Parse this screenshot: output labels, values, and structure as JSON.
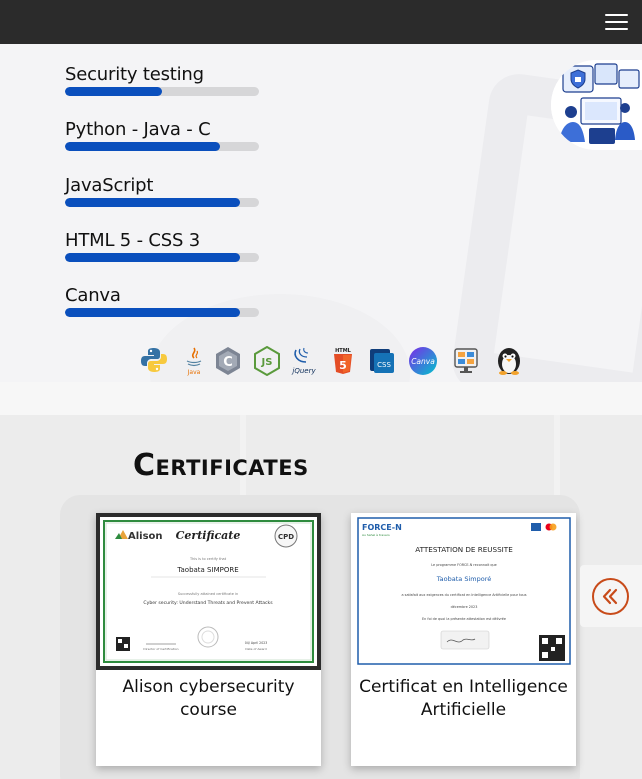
{
  "skills": [
    {
      "name": "Security testing",
      "level": 0.5
    },
    {
      "name": "Python - Java - C",
      "level": 0.8
    },
    {
      "name": "JavaScript",
      "level": 0.9
    },
    {
      "name": "HTML 5 - CSS 3",
      "level": 0.9
    },
    {
      "name": "Canva",
      "level": 0.9
    }
  ],
  "tech_icons": [
    "python-icon",
    "java-icon",
    "c-icon",
    "nodejs-icon",
    "jquery-icon",
    "html5-icon",
    "css3-icon",
    "canva-icon",
    "monitor-icon",
    "linux-icon"
  ],
  "tech_labels": {
    "java": "Java",
    "jquery": "jQuery",
    "html": "HTML",
    "css": "CSS",
    "canva": "Canva"
  },
  "certificates_title": "Certificates",
  "certificates": [
    {
      "caption": "Alison cybersecurity course",
      "doc": {
        "brand": "Alison",
        "heading": "Certificate",
        "intro": "This is to certify that",
        "name": "Taobata SIMPORE",
        "line": "Successfully attained certificate in",
        "course": "Cyber security: Understand Threats and Prevent Attacks",
        "role": "Director of Certification",
        "date": "04/ April 2023",
        "date_label": "Date of Award"
      }
    },
    {
      "caption": "Certificat en Intelligence Artificielle",
      "doc": {
        "brand": "FORCE-N",
        "tagline": "Au Sahel à travers",
        "heading": "ATTESTATION DE REUSSITE",
        "intro": "Le programme FORCE-N reconnait que",
        "name": "Taobata Simporé",
        "line": "a satisfait aux exigences du certificat en Intelligence Artificielle pour tous",
        "date": "décembre 2023",
        "footer": "En foi de quoi la présente attestation est délivrée"
      }
    }
  ],
  "colors": {
    "accent": "#0a4fbd",
    "nav_bg": "#2b2b2b",
    "arrow": "#c84b1a"
  }
}
